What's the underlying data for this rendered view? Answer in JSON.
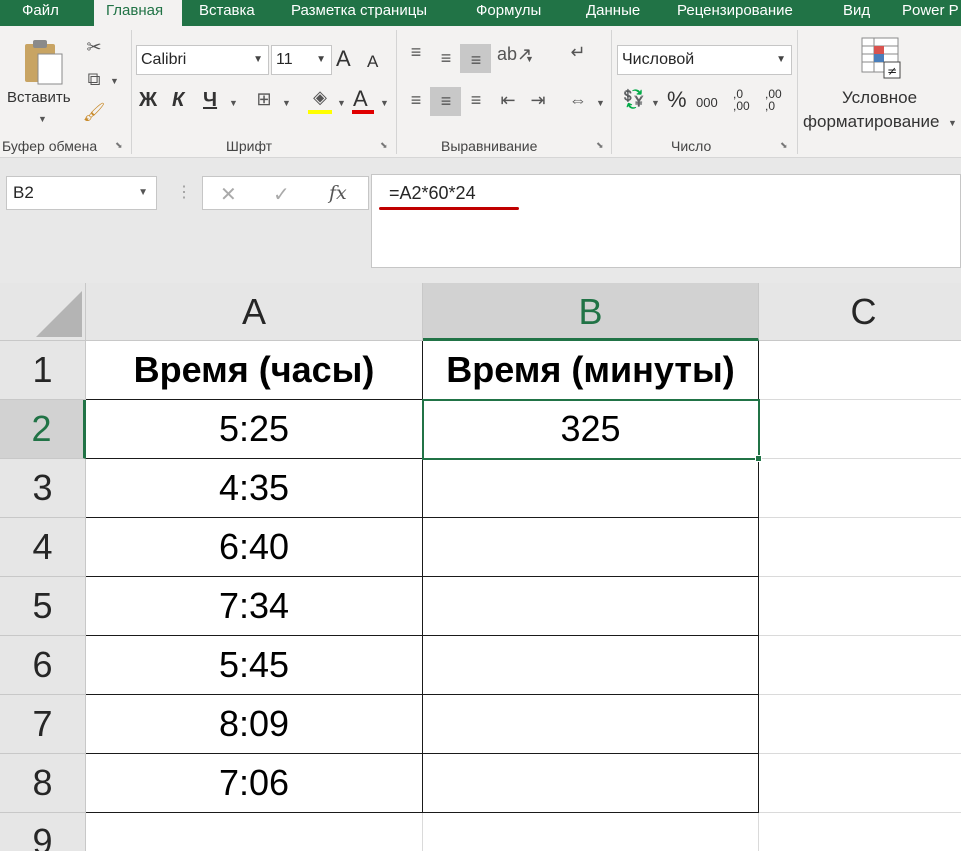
{
  "ribbon": {
    "tabs": [
      {
        "label": "Файл",
        "active": false
      },
      {
        "label": "Главная",
        "active": true
      },
      {
        "label": "Вставка",
        "active": false
      },
      {
        "label": "Разметка страницы",
        "active": false
      },
      {
        "label": "Формулы",
        "active": false
      },
      {
        "label": "Данные",
        "active": false
      },
      {
        "label": "Рецензирование",
        "active": false
      },
      {
        "label": "Вид",
        "active": false
      },
      {
        "label": "Power P",
        "active": false
      }
    ],
    "clipboard": {
      "paste_label": "Вставить",
      "group_label": "Буфер обмена"
    },
    "font": {
      "name": "Calibri",
      "size": "11",
      "bold": "Ж",
      "italic": "К",
      "underline": "Ч",
      "grow": "A",
      "shrink": "A",
      "color_letter": "A",
      "group_label": "Шрифт"
    },
    "alignment": {
      "group_label": "Выравнивание"
    },
    "number": {
      "format": "Числовой",
      "percent": "%",
      "thousands": "000",
      "inc_decimal": ",0 ,00",
      "dec_decimal": ",00 ,0",
      "group_label": "Число"
    },
    "styles": {
      "conditional_line1": "Условное",
      "conditional_line2": "форматирование"
    }
  },
  "formula_bar": {
    "name_box": "B2",
    "cancel": "✕",
    "enter": "✓",
    "fx": "fx",
    "formula": "=A2*60*24"
  },
  "sheet": {
    "columns": [
      "A",
      "B",
      "C"
    ],
    "rows": [
      "1",
      "2",
      "3",
      "4",
      "5",
      "6",
      "7",
      "8",
      "9"
    ],
    "header_a": "Время (часы)",
    "header_b": "Время (минуты)",
    "hours": [
      "5:25",
      "4:35",
      "6:40",
      "7:34",
      "5:45",
      "8:09",
      "7:06"
    ],
    "minutes": [
      "325",
      "",
      "",
      "",
      "",
      "",
      ""
    ],
    "selected_cell": "B2"
  },
  "colors": {
    "accent": "#217346",
    "underline_mark": "#c00000"
  }
}
